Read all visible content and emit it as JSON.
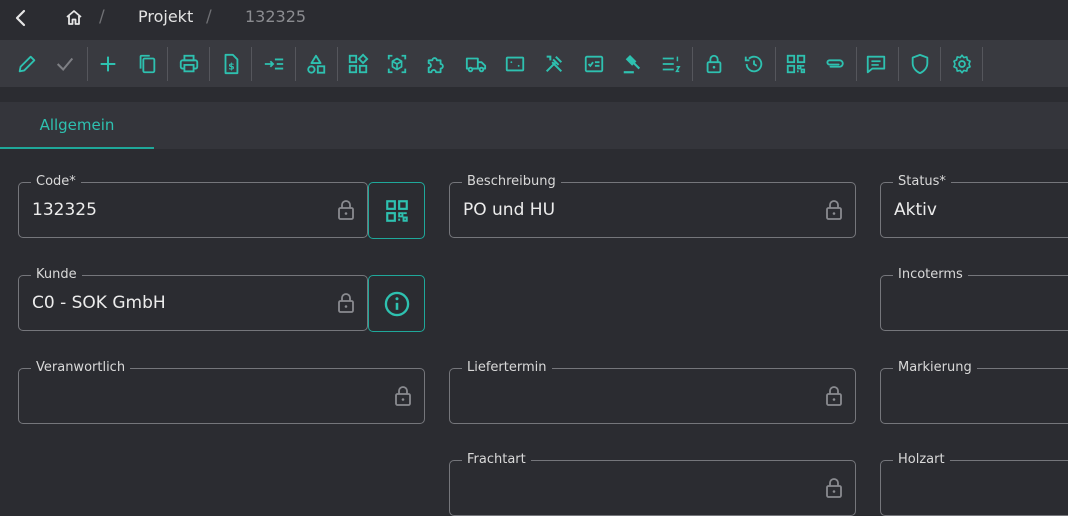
{
  "breadcrumb": {
    "items": [
      "Projekt",
      "132325"
    ]
  },
  "toolbar": {
    "buttons": [
      "edit-icon",
      "check-icon",
      "add-icon",
      "copy-icon",
      "print-icon",
      "invoice-icon",
      "indent-icon",
      "shapes-icon",
      "widgets-icon",
      "view-in-ar-icon",
      "extension-icon",
      "truck-icon",
      "crop-free-icon",
      "tools-icon",
      "checklist-icon",
      "gavel-icon",
      "ordered-list-icon",
      "lock-icon",
      "history-icon",
      "qr-code-icon",
      "attachment-icon",
      "comment-icon",
      "shield-icon",
      "settings-icon"
    ]
  },
  "tabs": [
    {
      "label": "Allgemein",
      "active": true
    }
  ],
  "form": {
    "code": {
      "label": "Code*",
      "value": "132325"
    },
    "beschreibung": {
      "label": "Beschreibung",
      "value": "PO und HU"
    },
    "status": {
      "label": "Status*",
      "value": "Aktiv"
    },
    "kunde": {
      "label": "Kunde",
      "value": "C0 - SOK GmbH"
    },
    "incoterms": {
      "label": "Incoterms",
      "value": ""
    },
    "veranwortlich": {
      "label": "Veranwortlich",
      "value": ""
    },
    "liefertermin": {
      "label": "Liefertermin",
      "value": ""
    },
    "markierung": {
      "label": "Markierung",
      "value": ""
    },
    "frachtart": {
      "label": "Frachtart",
      "value": ""
    },
    "holzart": {
      "label": "Holzart",
      "value": ""
    }
  },
  "colors": {
    "accent": "#1fa89a",
    "background": "#2b2c31",
    "toolbar": "#393a40"
  }
}
